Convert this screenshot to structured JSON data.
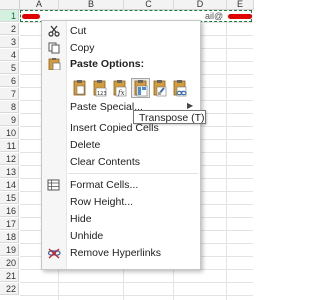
{
  "columns": [
    "A",
    "B",
    "C",
    "D",
    "E"
  ],
  "rows": [
    "1",
    "2",
    "3",
    "4",
    "5",
    "6",
    "7",
    "8",
    "9",
    "10",
    "11",
    "12",
    "13",
    "14",
    "15",
    "16",
    "17",
    "18",
    "19",
    "20",
    "21",
    "22"
  ],
  "cell_fragment": "ail@",
  "menu": {
    "cut": "Cut",
    "copy": "Copy",
    "paste_options": "Paste Options:",
    "paste_special": "Paste Special...",
    "insert_copied_cells": "Insert Copied Cells",
    "delete": "Delete",
    "clear_contents": "Clear Contents",
    "format_cells": "Format Cells...",
    "row_height": "Row Height...",
    "hide": "Hide",
    "unhide": "Unhide",
    "remove_hyperlinks": "Remove Hyperlinks"
  },
  "paste_icons": [
    "paste-icon",
    "paste-values-icon",
    "paste-formulas-icon",
    "paste-transpose-icon",
    "paste-formatting-icon",
    "paste-link-icon"
  ],
  "tooltip": "Transpose (T)",
  "colors": {
    "annotation": "#e00000",
    "selection": "#1e7b3e",
    "header_active": "#d3f0e0"
  }
}
